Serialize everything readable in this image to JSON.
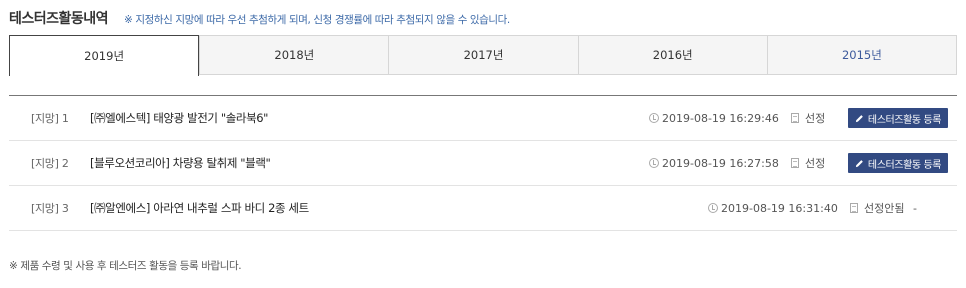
{
  "header": {
    "title": "테스터즈활동내역",
    "notice": "※  지정하신 지망에 따라 우선 추첨하게 되며, 신청 경쟁률에 따라 추첨되지 않을 수 있습니다."
  },
  "tabs": [
    {
      "label": "2019년"
    },
    {
      "label": "2018년"
    },
    {
      "label": "2017년"
    },
    {
      "label": "2016년"
    },
    {
      "label": "2015년"
    }
  ],
  "activities": [
    {
      "rank": "[지망] 1",
      "product": "[㈜엘에스텍] 태양광 발전기 \"솔라북6\"",
      "datetime": "2019-08-19 16:29:46",
      "status": "선정",
      "action": "테스터즈활동 등록"
    },
    {
      "rank": "[지망] 2",
      "product": "[블루오션코리아] 차량용 탈취제 \"블랙\"",
      "datetime": "2019-08-19 16:27:58",
      "status": "선정",
      "action": "테스터즈활동 등록"
    },
    {
      "rank": "[지망] 3",
      "product": "[㈜알엔에스] 아라연 내추럴 스파 바디 2종 세트",
      "datetime": "2019-08-19 16:31:40",
      "status": "선정안됨",
      "extra": "-"
    }
  ],
  "footer": {
    "note": "※  제품 수령 및 사용 후 테스터즈 활동을 등록 바랍니다."
  },
  "icons": {
    "clock": "clock-icon",
    "document": "document-icon",
    "pencil": "pencil-icon"
  },
  "colors": {
    "accent": "#324a82",
    "notice": "#3d6aa8",
    "tab_last": "#3d5a9c"
  }
}
